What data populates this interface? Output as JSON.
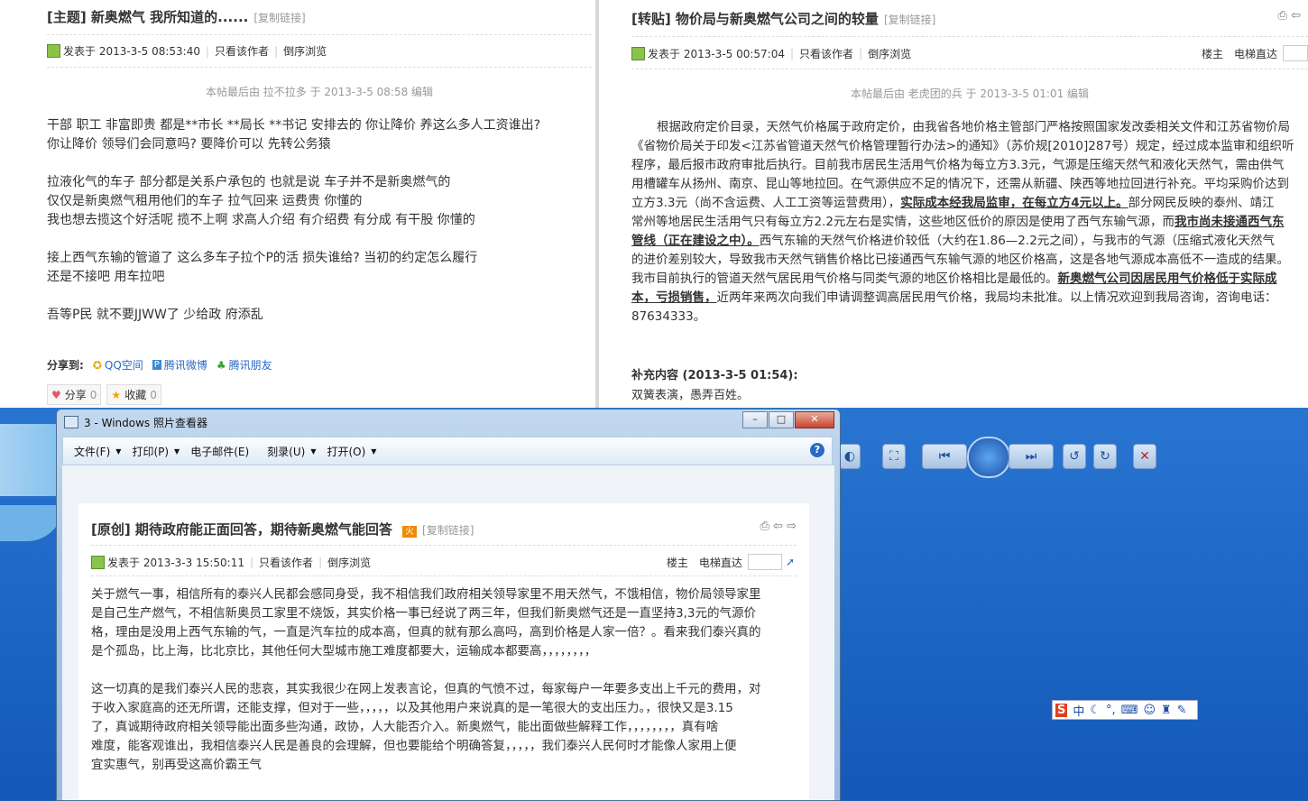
{
  "left_post": {
    "title": "[主题] 新奥燃气 我所知道的......",
    "copy_link": "[复制链接]",
    "posted": "发表于 2013-3-5 08:53:40",
    "only_author": "只看该作者",
    "reverse": "倒序浏览",
    "edited": "本帖最后由 拉不拉多 于 2013-3-5 08:58 编辑",
    "body": "干部  职工  非富即贵   都是**市长   **局长  **书记 安排去的   你让降价   养这么多人工资谁出?\n你让降价  领导们会同意吗?  要降价可以 先转公务猿\n\n拉液化气的车子   部分都是关系户承包的   也就是说  车子并不是新奥燃气的\n仅仅是新奥燃气租用他们的车子  拉气回来    运费贵  你懂的\n我也想去揽这个好活呢  揽不上啊   求高人介绍  有介绍费  有分成  有干股  你懂的\n\n接上西气东输的管道了   这么多车子拉个P的活   损失谁给? 当初的约定怎么履行\n还是不接吧    用车拉吧\n\n吾等P民 就不要JJWW了  少给政  府添乱",
    "share_label": "分享到:",
    "share_qzone": "QQ空间",
    "share_weibo": "腾讯微博",
    "share_friends": "腾讯朋友",
    "btn_share": "分享",
    "btn_share_count": "0",
    "btn_fav": "收藏",
    "btn_fav_count": "0"
  },
  "right_post": {
    "title": "[转贴] 物价局与新奥燃气公司之间的较量",
    "copy_link": "[复制链接]",
    "posted": "发表于 2013-3-5 00:57:04",
    "only_author": "只看该作者",
    "reverse": "倒序浏览",
    "floor": "楼主",
    "elevator": "电梯直达",
    "edited": "本帖最后由 老虎团的兵 于 2013-3-5 01:01 编辑",
    "p1": "根据政府定价目录，天然气价格属于政府定价，由我省各地价格主管部门严格按照国家发改委相关文件和江苏省物价局",
    "p2": "《省物价局关于印发<江苏省管道天然气价格管理暂行办法>的通知》（苏价规[2010]287号）规定，经过成本监审和组织听",
    "p3": "程序，最后报市政府审批后执行。目前我市居民生活用气价格为每立方3.3元，气源是压缩天然气和液化天然气，需由供气",
    "p4": "用槽罐车从扬州、南京、昆山等地拉回。在气源供应不足的情况下，还需从新疆、陕西等地拉回进行补充。平均采购价达到",
    "p5a": "立方3.3元（尚不含运费、人工工资等运营费用），",
    "p5b": "实际成本经我局监审，在每立方4元以上。",
    "p5c": "部分网民反映的泰州、靖江",
    "p6a": "常州等地居民生活用气只有每立方2.2元左右是实情，这些地区低价的原因是使用了西气东输气源，而",
    "p6b": "我市尚未接通西气东",
    "p7a": "管线（正在建设之中）。",
    "p7b": "西气东输的天然气价格进价较低（大约在1.86—2.2元之间），与我市的气源（压缩式液化天然气",
    "p8": "的进价差别较大，导致我市天然气销售价格比已接通西气东输气源的地区价格高，这是各地气源成本高低不一造成的结果。",
    "p9a": "我市目前执行的管道天然气居民用气价格与同类气源的地区价格相比是最低的。",
    "p9b": "新奥燃气公司因居民用气价格低于实际成",
    "p10a": "本，亏损销售，",
    "p10b": "近两年来两次向我们申请调整调高居民用气价格，我局均未批准。以上情况欢迎到我局咨询，咨询电话：",
    "p11": "87634333。",
    "supplement_title": "补充内容 (2013-3-5 01:54):",
    "supplement": "双簧表演，愚弄百姓。"
  },
  "viewer": {
    "window_title": "3 - Windows 照片查看器",
    "menu": [
      "文件(F)",
      "打印(P)",
      "电子邮件(E)",
      "刻录(U)",
      "打开(O)"
    ],
    "help": "?",
    "post": {
      "title": "[原创] 期待政府能正面回答，期待新奥燃气能回答",
      "copy_link": "[复制链接]",
      "posted": "发表于 2013-3-3 15:50:11",
      "only_author": "只看该作者",
      "reverse": "倒序浏览",
      "floor": "楼主",
      "elevator": "电梯直达",
      "body": "关于燃气一事，相信所有的泰兴人民都会感同身受，我不相信我们政府相关领导家里不用天然气，不饿相信，物价局领导家里\n是自己生产燃气，不相信新奥员工家里不烧饭，其实价格一事已经说了两三年，但我们新奥燃气还是一直坚持3,3元的气源价\n格，理由是没用上西气东输的气，一直是汽车拉的成本高，但真的就有那么高吗，高到价格是人家一倍？。看来我们泰兴真的\n是个孤岛，比上海，比北京比，其他任何大型城市施工难度都要大，运输成本都要高，，，，，，，，\n\n这一切真的是我们泰兴人民的悲哀，其实我很少在网上发表言论，但真的气愤不过，每家每户一年要多支出上千元的费用，对\n于收入家庭高的还无所谓，还能支撑，但对于一些，，，，，以及其他用户来说真的是一笔很大的支出压力。，很快又是3.15\n了，真诚期待政府相关领导能出面多些沟通，政协，人大能否介入。新奥燃气，能出面做些解释工作，，，，，，，，真有啥\n难度，能客观谁出，我相信泰兴人民是善良的会理解，但也要能给个明确答复，，，，，我们泰兴人民何时才能像人家用上便\n宜实惠气，别再受这高价霸王气"
    }
  },
  "ime": {
    "label": "中"
  }
}
